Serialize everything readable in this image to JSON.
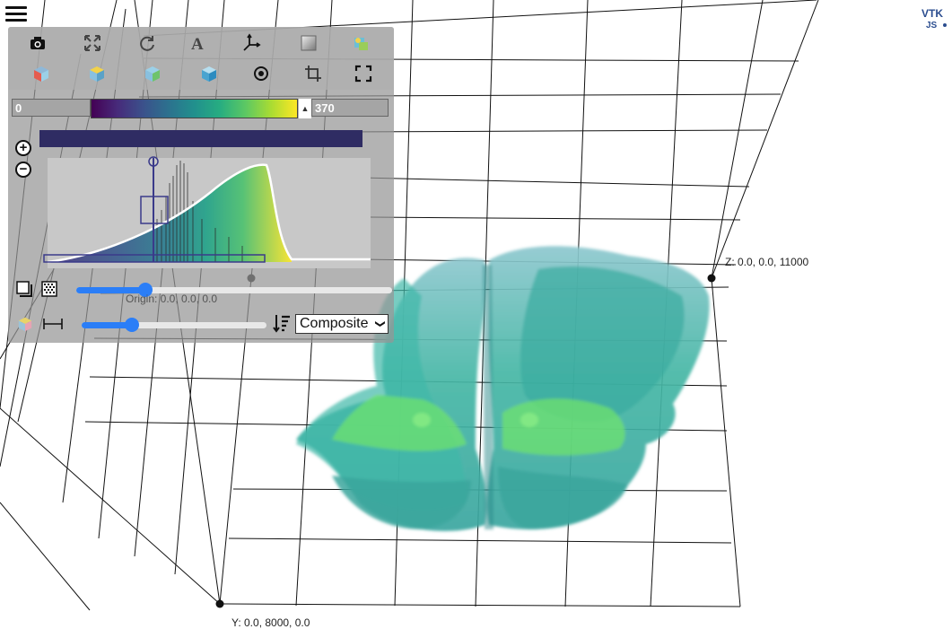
{
  "menu": {
    "icon": "hamburger-menu-icon"
  },
  "logo": {
    "line1": "VTK",
    "line2": "JS"
  },
  "toolbar": {
    "row1": [
      "camera-icon",
      "reset-camera-icon",
      "rotate-icon",
      "text-annotation-icon",
      "axes-icon",
      "background-icon",
      "lighting-icon"
    ],
    "row2": [
      "view-x-icon",
      "view-y-icon",
      "view-z-icon",
      "view-iso-icon",
      "center-icon",
      "crop-icon",
      "fullscreen-icon"
    ]
  },
  "colormap": {
    "min_value": "0",
    "max_value": "370",
    "preset": "viridis"
  },
  "transfer_function": {
    "zoom_in": "+",
    "zoom_out": "−"
  },
  "controls": {
    "sample_distance_fraction": 0.22,
    "edge_gradient_fraction": 0.27,
    "origin_label": "Origin: 0.0, 0.0, 0.0",
    "blend_mode": "Composite"
  },
  "axes": {
    "z_label": "Z: 0.0, 0.0, 11000",
    "y_label": "Y: 0.0, 8000, 0.0"
  }
}
